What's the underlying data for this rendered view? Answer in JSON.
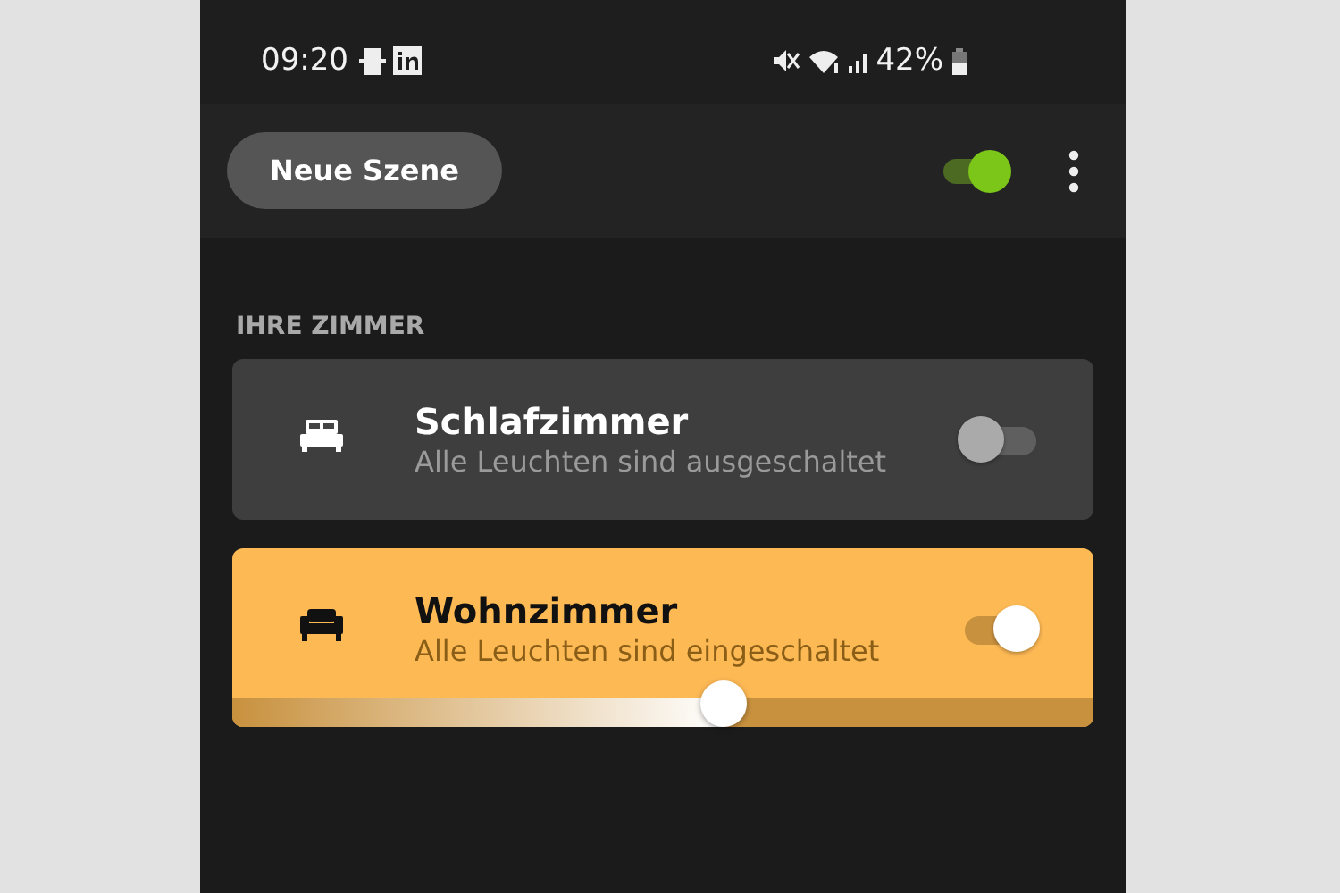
{
  "status_bar": {
    "time": "09:20",
    "battery": "42%"
  },
  "header": {
    "button": "Neue Szene",
    "master_on": true
  },
  "section_title": "IHRE ZIMMER",
  "rooms": [
    {
      "name": "Schlafzimmer",
      "status": "Alle Leuchten sind ausgeschaltet",
      "on": false
    },
    {
      "name": "Wohnzimmer",
      "status": "Alle Leuchten sind eingeschaltet",
      "on": true,
      "level": 0.57
    }
  ]
}
